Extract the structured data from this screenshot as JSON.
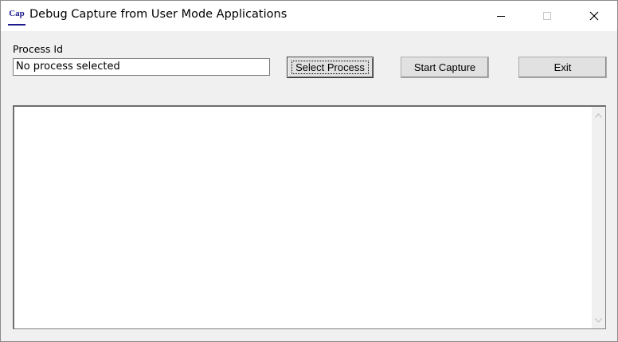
{
  "window": {
    "icon_text": "Cap",
    "title": "Debug Capture from User Mode Applications"
  },
  "form": {
    "process_label": "Process Id",
    "process_value": "No process selected",
    "select_button": "Select Process",
    "start_button": "Start Capture",
    "exit_button": "Exit"
  },
  "output": {
    "text": ""
  },
  "icons": {
    "minimize": "minimize-icon",
    "maximize": "maximize-icon",
    "close": "close-icon",
    "scroll_up": "chevron-up-icon",
    "scroll_down": "chevron-down-icon"
  }
}
